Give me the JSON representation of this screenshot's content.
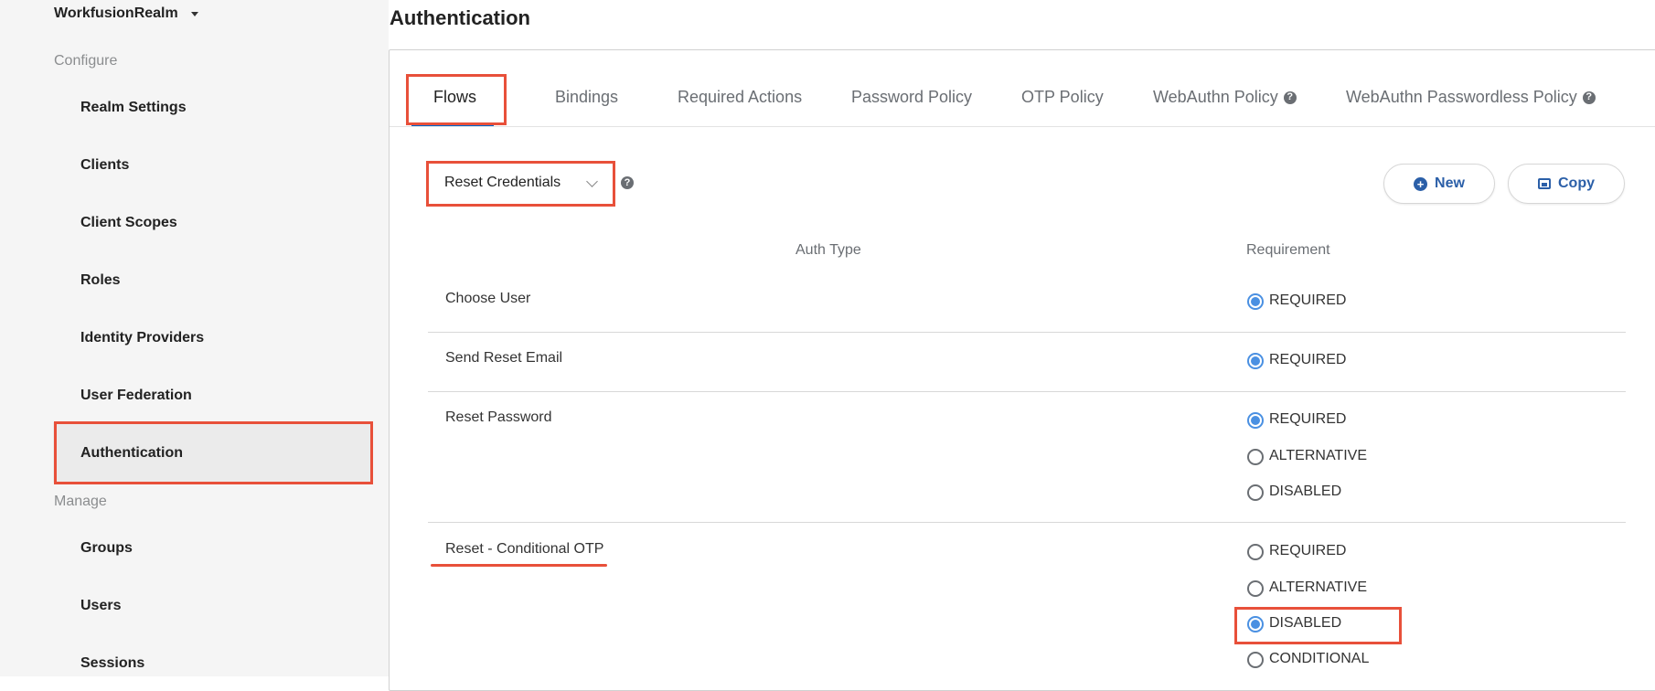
{
  "sidebar": {
    "realm": "WorkfusionRealm",
    "configure_label": "Configure",
    "manage_label": "Manage",
    "configure_items": [
      {
        "label": "Realm Settings"
      },
      {
        "label": "Clients"
      },
      {
        "label": "Client Scopes"
      },
      {
        "label": "Roles"
      },
      {
        "label": "Identity Providers"
      },
      {
        "label": "User Federation"
      },
      {
        "label": "Authentication"
      }
    ],
    "manage_items": [
      {
        "label": "Groups"
      },
      {
        "label": "Users"
      },
      {
        "label": "Sessions"
      }
    ]
  },
  "page": {
    "title": "Authentication"
  },
  "tabs": [
    {
      "label": "Flows"
    },
    {
      "label": "Bindings"
    },
    {
      "label": "Required Actions"
    },
    {
      "label": "Password Policy"
    },
    {
      "label": "OTP Policy"
    },
    {
      "label": "WebAuthn Policy"
    },
    {
      "label": "WebAuthn Passwordless Policy"
    }
  ],
  "flow_select": {
    "value": "Reset Credentials"
  },
  "buttons": {
    "new": "New",
    "copy": "Copy"
  },
  "table": {
    "headers": {
      "auth_type": "Auth Type",
      "requirement": "Requirement"
    },
    "rows": [
      {
        "auth_type": "Choose User",
        "options": [
          "REQUIRED"
        ]
      },
      {
        "auth_type": "Send Reset Email",
        "options": [
          "REQUIRED"
        ]
      },
      {
        "auth_type": "Reset Password",
        "options": [
          "REQUIRED",
          "ALTERNATIVE",
          "DISABLED"
        ]
      },
      {
        "auth_type": "Reset - Conditional OTP",
        "options": [
          "REQUIRED",
          "ALTERNATIVE",
          "DISABLED",
          "CONDITIONAL"
        ]
      }
    ]
  },
  "colors": {
    "accent": "#4a90e2",
    "annotation": "#e8503a",
    "link": "#2b5fa8"
  }
}
